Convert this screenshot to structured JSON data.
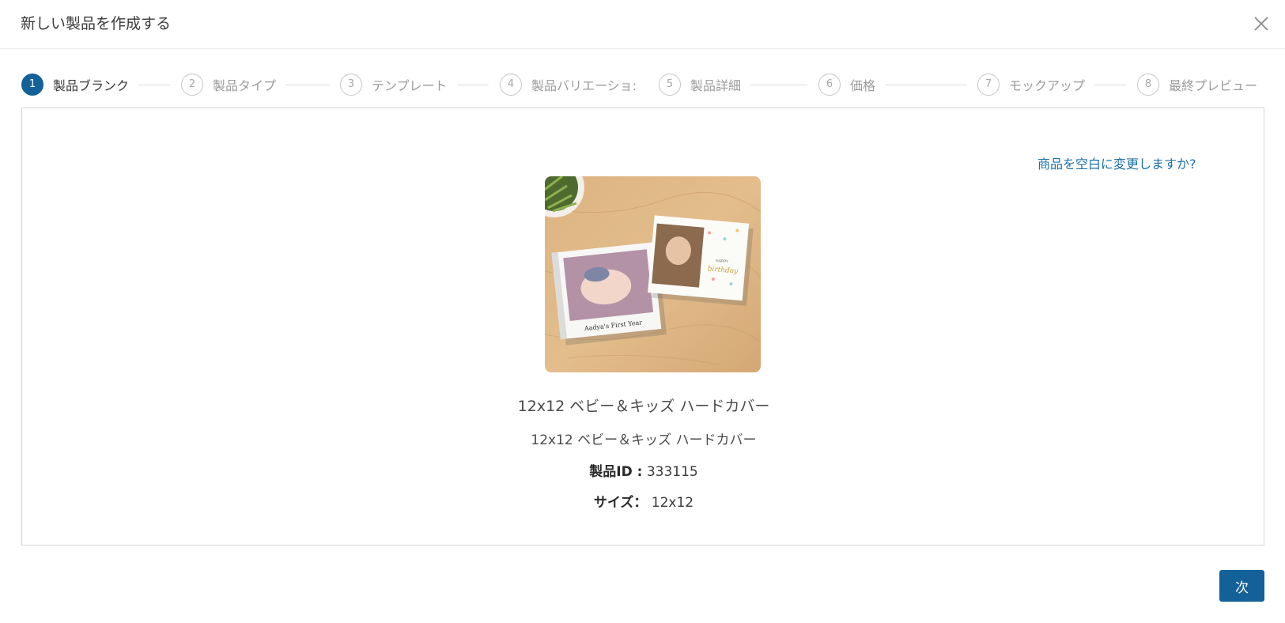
{
  "header": {
    "title": "新しい製品を作成する",
    "close_icon": "close-icon"
  },
  "stepper": {
    "current_step": 1,
    "steps": [
      {
        "number": "1",
        "label": "製品ブランク"
      },
      {
        "number": "2",
        "label": "製品タイプ"
      },
      {
        "number": "3",
        "label": "テンプレート"
      },
      {
        "number": "4",
        "label": "製品バリエーショ:"
      },
      {
        "number": "5",
        "label": "製品詳細"
      },
      {
        "number": "6",
        "label": "価格"
      },
      {
        "number": "7",
        "label": "モックアップ"
      },
      {
        "number": "8",
        "label": "最終プレビュー"
      }
    ]
  },
  "panel": {
    "change_link": "商品を空白に変更しますか?",
    "product": {
      "name": "12x12 ベビー＆キッズ ハードカバー",
      "description": "12x12 ベビー＆キッズ ハードカバー",
      "id_label": "製品ID :",
      "id_value": "333115",
      "size_label": "サイズ：",
      "size_value": "12x12",
      "image_text_left": "Aadya's First Year",
      "image_text_right_top": "HAPPY",
      "image_text_right": "birthday"
    }
  },
  "footer": {
    "next_label": "次"
  },
  "colors": {
    "accent": "#136198",
    "link": "#1b6fa6",
    "wood": "#d9b07c"
  }
}
